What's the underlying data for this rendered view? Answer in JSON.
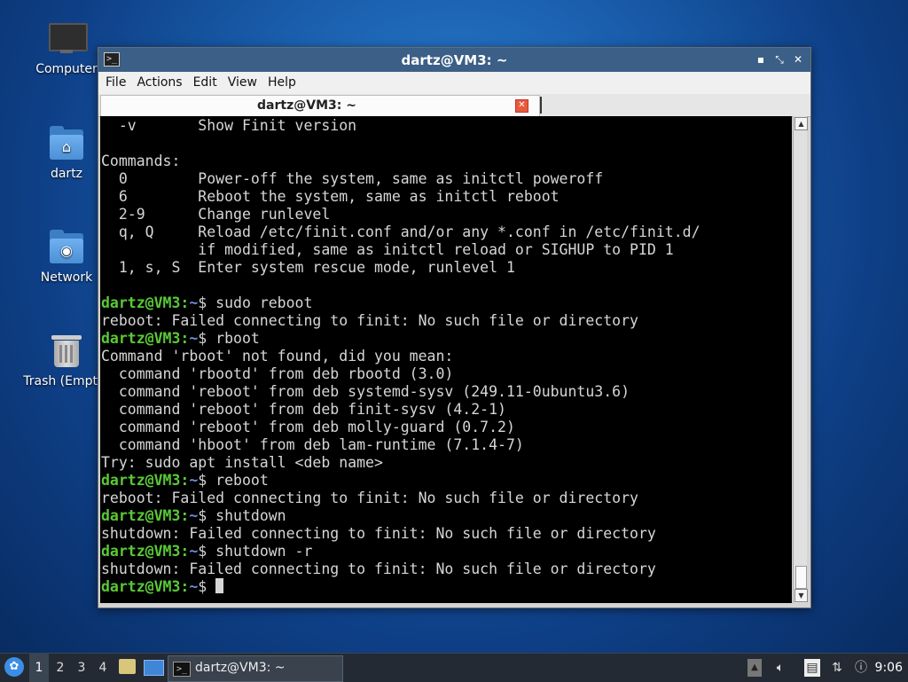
{
  "desktop": {
    "icons": [
      {
        "label": "Computer"
      },
      {
        "label": "dartz"
      },
      {
        "label": "Network"
      },
      {
        "label": "Trash (Empty)"
      }
    ]
  },
  "window": {
    "title": "dartz@VM3: ~",
    "controls": {
      "minimize": "▪",
      "maximize": "⤡",
      "close": "✕"
    },
    "menu": [
      "File",
      "Actions",
      "Edit",
      "View",
      "Help"
    ],
    "tab": {
      "label": "dartz@VM3: ~",
      "close": "✕"
    }
  },
  "terminal": {
    "prompt_user": "dartz@VM3",
    "prompt_path": "~",
    "lines": [
      {
        "type": "out",
        "text": "  -v       Show Finit version"
      },
      {
        "type": "out",
        "text": ""
      },
      {
        "type": "out",
        "text": "Commands:"
      },
      {
        "type": "out",
        "text": "  0        Power-off the system, same as initctl poweroff"
      },
      {
        "type": "out",
        "text": "  6        Reboot the system, same as initctl reboot"
      },
      {
        "type": "out",
        "text": "  2-9      Change runlevel"
      },
      {
        "type": "out",
        "text": "  q, Q     Reload /etc/finit.conf and/or any *.conf in /etc/finit.d/"
      },
      {
        "type": "out",
        "text": "           if modified, same as initctl reload or SIGHUP to PID 1"
      },
      {
        "type": "out",
        "text": "  1, s, S  Enter system rescue mode, runlevel 1"
      },
      {
        "type": "out",
        "text": ""
      },
      {
        "type": "cmd",
        "text": "sudo reboot"
      },
      {
        "type": "out",
        "text": "reboot: Failed connecting to finit: No such file or directory"
      },
      {
        "type": "cmd",
        "text": "rboot"
      },
      {
        "type": "out",
        "text": "Command 'rboot' not found, did you mean:"
      },
      {
        "type": "out",
        "text": "  command 'rbootd' from deb rbootd (3.0)"
      },
      {
        "type": "out",
        "text": "  command 'reboot' from deb systemd-sysv (249.11-0ubuntu3.6)"
      },
      {
        "type": "out",
        "text": "  command 'reboot' from deb finit-sysv (4.2-1)"
      },
      {
        "type": "out",
        "text": "  command 'reboot' from deb molly-guard (0.7.2)"
      },
      {
        "type": "out",
        "text": "  command 'hboot' from deb lam-runtime (7.1.4-7)"
      },
      {
        "type": "out",
        "text": "Try: sudo apt install <deb name>"
      },
      {
        "type": "cmd",
        "text": "reboot"
      },
      {
        "type": "out",
        "text": "reboot: Failed connecting to finit: No such file or directory"
      },
      {
        "type": "cmd",
        "text": "shutdown"
      },
      {
        "type": "out",
        "text": "shutdown: Failed connecting to finit: No such file or directory"
      },
      {
        "type": "cmd",
        "text": "shutdown -r"
      },
      {
        "type": "out",
        "text": "shutdown: Failed connecting to finit: No such file or directory"
      },
      {
        "type": "input",
        "text": ""
      }
    ]
  },
  "taskbar": {
    "workspaces": [
      "1",
      "2",
      "3",
      "4"
    ],
    "active_workspace": "1",
    "task_label": "dartz@VM3: ~",
    "clock": "9:06"
  }
}
